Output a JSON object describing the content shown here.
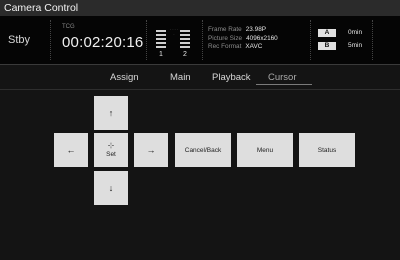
{
  "window": {
    "title": "Camera Control"
  },
  "status": {
    "mode": "Stby",
    "timecode_label": "TCG",
    "timecode": "00:02:20:16",
    "audio_channels": [
      "1",
      "2"
    ],
    "frame_rate_label": "Frame Rate",
    "frame_rate": "23.98P",
    "picture_size_label": "Picture Size",
    "picture_size": "4096x2160",
    "rec_format_label": "Rec Format",
    "rec_format": "XAVC",
    "media": [
      {
        "slot": "A",
        "remaining": "0min"
      },
      {
        "slot": "B",
        "remaining": "5min"
      }
    ]
  },
  "tabs": [
    {
      "label": "Assign"
    },
    {
      "label": "Main"
    },
    {
      "label": "Playback"
    },
    {
      "label": "Cursor",
      "active": true
    }
  ],
  "controls": {
    "up": "↑",
    "down": "↓",
    "left": "←",
    "right": "→",
    "set_symbol": "⊹",
    "set": "Set",
    "cancel_back": "Cancel/Back",
    "menu": "Menu",
    "status": "Status"
  }
}
